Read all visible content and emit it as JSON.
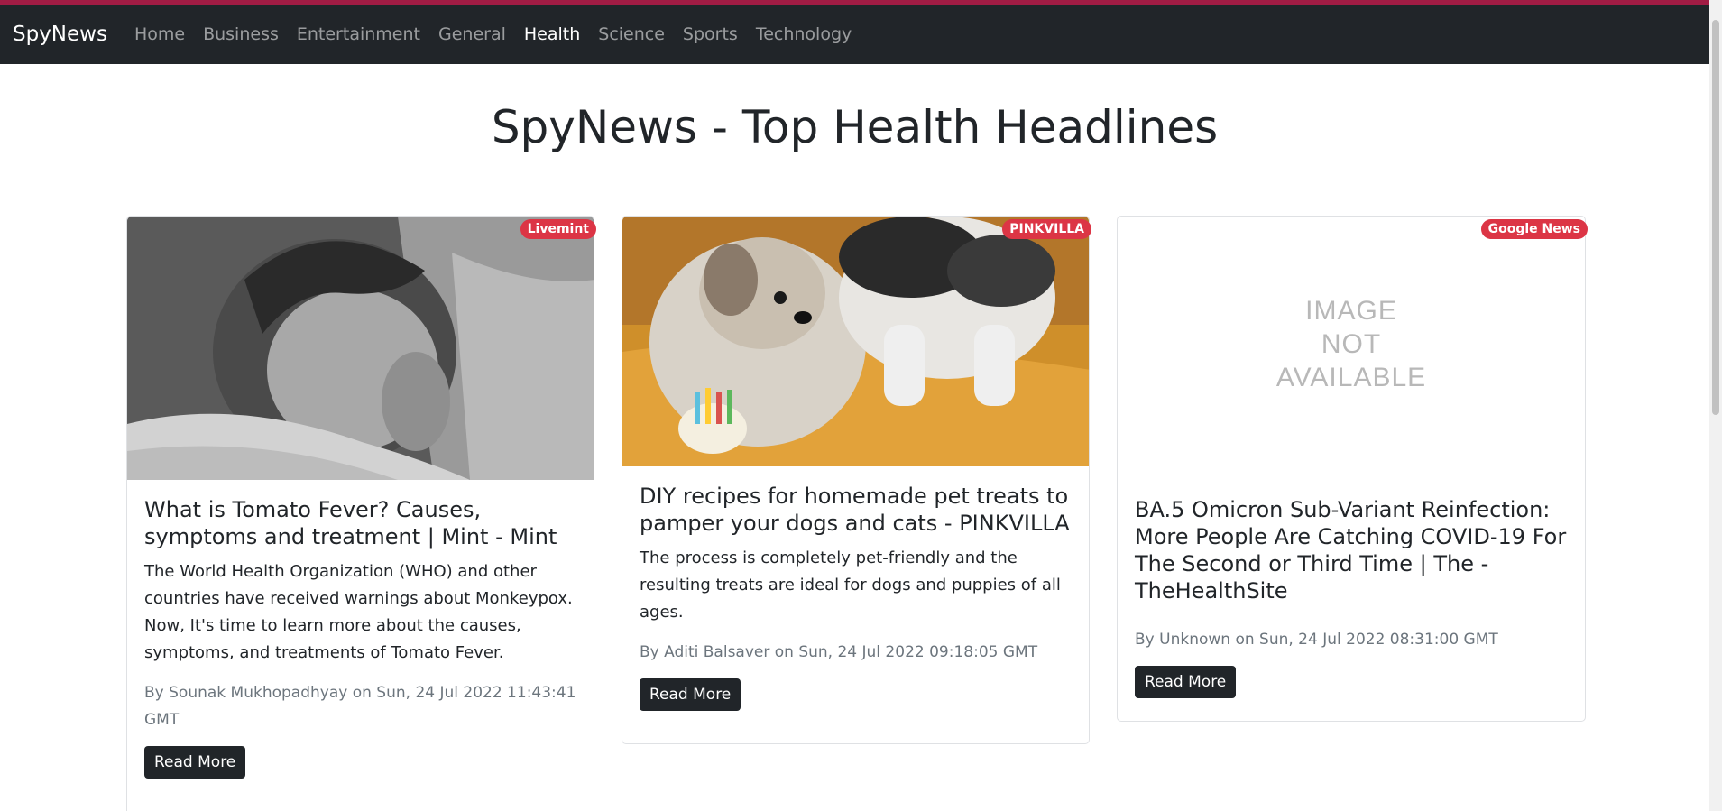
{
  "navbar": {
    "brand": "SpyNews",
    "items": [
      {
        "label": "Home"
      },
      {
        "label": "Business"
      },
      {
        "label": "Entertainment"
      },
      {
        "label": "General"
      },
      {
        "label": "Health"
      },
      {
        "label": "Science"
      },
      {
        "label": "Sports"
      },
      {
        "label": "Technology"
      }
    ],
    "active": "Health"
  },
  "page": {
    "title": "SpyNews - Top Health Headlines"
  },
  "colors": {
    "navbar_bg": "#212529",
    "top_accent": "#a11c44",
    "badge_bg": "#dc3545",
    "button_bg": "#212529"
  },
  "articles": [
    {
      "source": "Livemint",
      "title": "What is Tomato Fever? Causes, symptoms and treatment | Mint - Mint",
      "description": "The World Health Organization (WHO) and other countries have received warnings about Monkeypox. Now, It's time to learn more about the causes, symptoms, and treatments of Tomato Fever.",
      "meta": "By Sounak Mukhopadhyay on Sun, 24 Jul 2022 11:43:41 GMT",
      "button": "Read More"
    },
    {
      "source": "PINKVILLA",
      "title": "DIY recipes for homemade pet treats to pamper your dogs and cats - PINKVILLA",
      "description": "The process is completely pet-friendly and the resulting treats are ideal for dogs and puppies of all ages.",
      "meta": "By Aditi Balsaver on Sun, 24 Jul 2022 09:18:05 GMT",
      "button": "Read More"
    },
    {
      "source": "Google News",
      "title": "BA.5 Omicron Sub-Variant Reinfection: More People Are Catching COVID-19 For The Second or Third Time | The - TheHealthSite",
      "description": "",
      "meta": "By Unknown on Sun, 24 Jul 2022 08:31:00 GMT",
      "button": "Read More",
      "image_placeholder": [
        "IMAGE",
        "NOT",
        "AVAILABLE"
      ]
    }
  ]
}
